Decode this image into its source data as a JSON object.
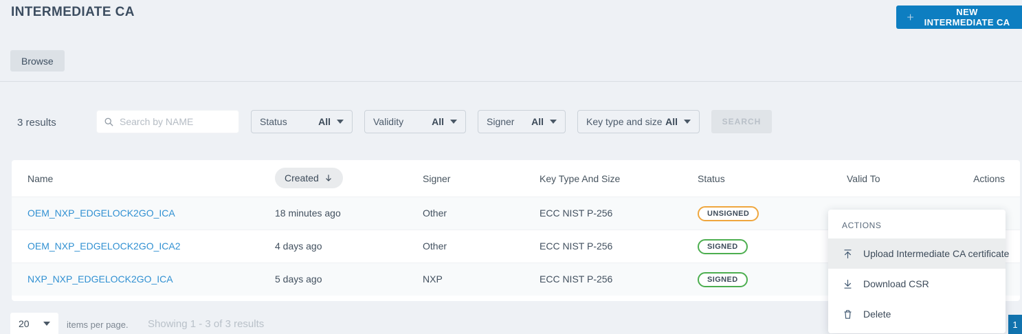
{
  "page": {
    "title": "INTERMEDIATE CA"
  },
  "header": {
    "new_button_label": "NEW INTERMEDIATE CA"
  },
  "tabs": {
    "browse": "Browse"
  },
  "filters": {
    "results_count": "3 results",
    "search": {
      "placeholder": "Search by NAME",
      "value": ""
    },
    "dropdowns": [
      {
        "label": "Status",
        "value": "All"
      },
      {
        "label": "Validity",
        "value": "All"
      },
      {
        "label": "Signer",
        "value": "All"
      },
      {
        "label": "Key type and size",
        "value": "All"
      }
    ],
    "search_button_label": "SEARCH"
  },
  "table": {
    "columns": [
      "Name",
      "Created",
      "Signer",
      "Key Type And Size",
      "Status",
      "Valid To",
      "Actions"
    ],
    "sort": {
      "column": "Created",
      "direction": "desc"
    },
    "rows": [
      {
        "name": "OEM_NXP_EDGELOCK2GO_ICA",
        "created": "18 minutes ago",
        "signer": "Other",
        "key_type_and_size": "ECC NIST P-256",
        "status": "UNSIGNED",
        "status_variant": "warning"
      },
      {
        "name": "OEM_NXP_EDGELOCK2GO_ICA2",
        "created": "4 days ago",
        "signer": "Other",
        "key_type_and_size": "ECC NIST P-256",
        "status": "SIGNED",
        "status_variant": "success"
      },
      {
        "name": "NXP_NXP_EDGELOCK2GO_ICA",
        "created": "5 days ago",
        "signer": "NXP",
        "key_type_and_size": "ECC NIST P-256",
        "status": "SIGNED",
        "status_variant": "success"
      }
    ]
  },
  "actions_menu": {
    "title": "ACTIONS",
    "items": [
      {
        "label": "Upload Intermediate CA certificate",
        "icon": "upload-icon",
        "highlighted": true
      },
      {
        "label": "Download CSR",
        "icon": "download-icon",
        "highlighted": false
      },
      {
        "label": "Delete",
        "icon": "trash-icon",
        "highlighted": false
      }
    ]
  },
  "pagination": {
    "items_per_page": "20",
    "items_per_page_label": "items per page.",
    "showing_text": "Showing 1 - 3 of 3 results",
    "current_page": "1"
  },
  "colors": {
    "accent_blue": "#0d7ec1",
    "link_blue": "#3090d2",
    "badge_warning": "#efa63d",
    "badge_success": "#4cae4f",
    "page_background": "#eef1f5",
    "pagination_blue": "#1173ae"
  }
}
